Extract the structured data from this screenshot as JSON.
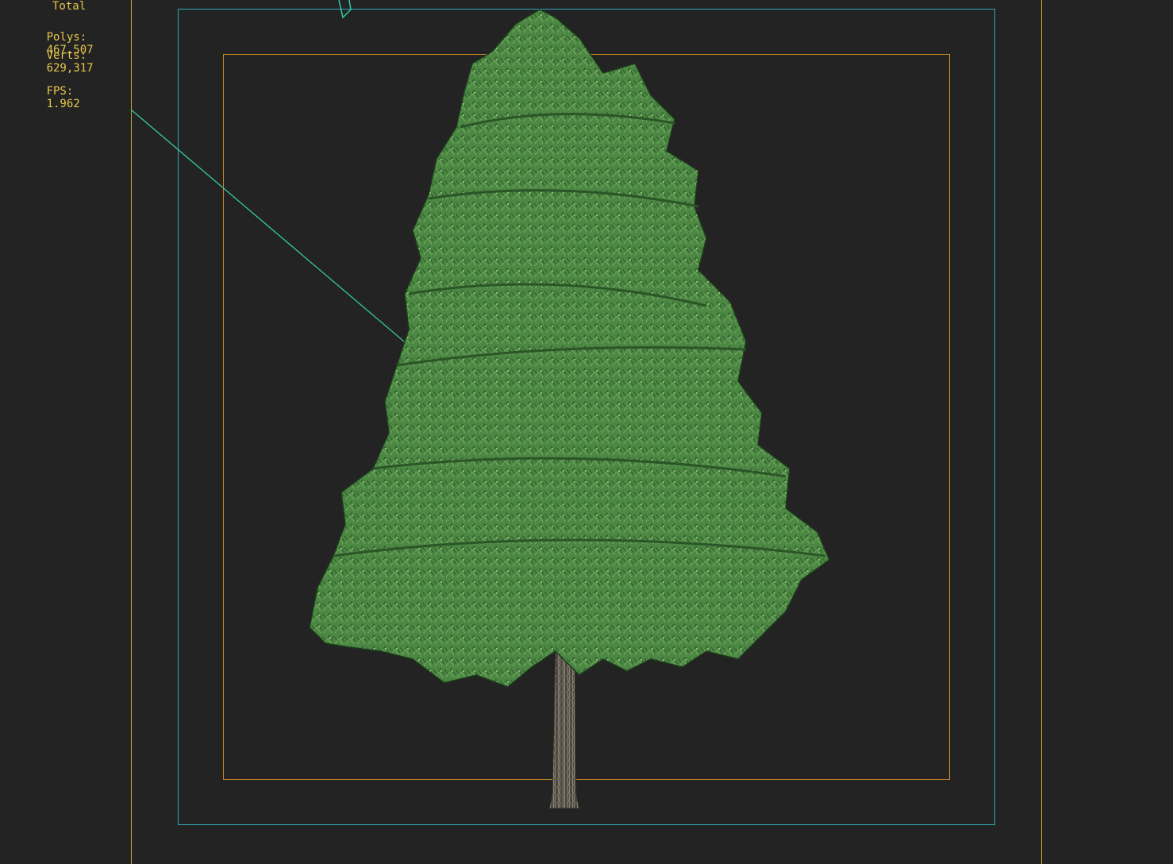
{
  "viewport": {
    "background_color": "#232323",
    "stats": {
      "header": "Total",
      "polys_label": "Polys:",
      "polys_value": "467,507",
      "verts_label": "Verts:",
      "verts_value": "629,317",
      "fps_label": "FPS:",
      "fps_value": "1.962",
      "text_color": "#e8c84a"
    },
    "frames": {
      "viewport_border_color": "#c7a52e",
      "safe_frame_outer_color": "#2fa9b5",
      "safe_frame_inner_color": "#c68a22"
    },
    "scene_objects": [
      {
        "name": "tree",
        "foliage_color": "#4f8a45",
        "trunk_color": "#5b5247"
      },
      {
        "name": "camera-target-line",
        "color": "#33c9a4"
      }
    ]
  }
}
